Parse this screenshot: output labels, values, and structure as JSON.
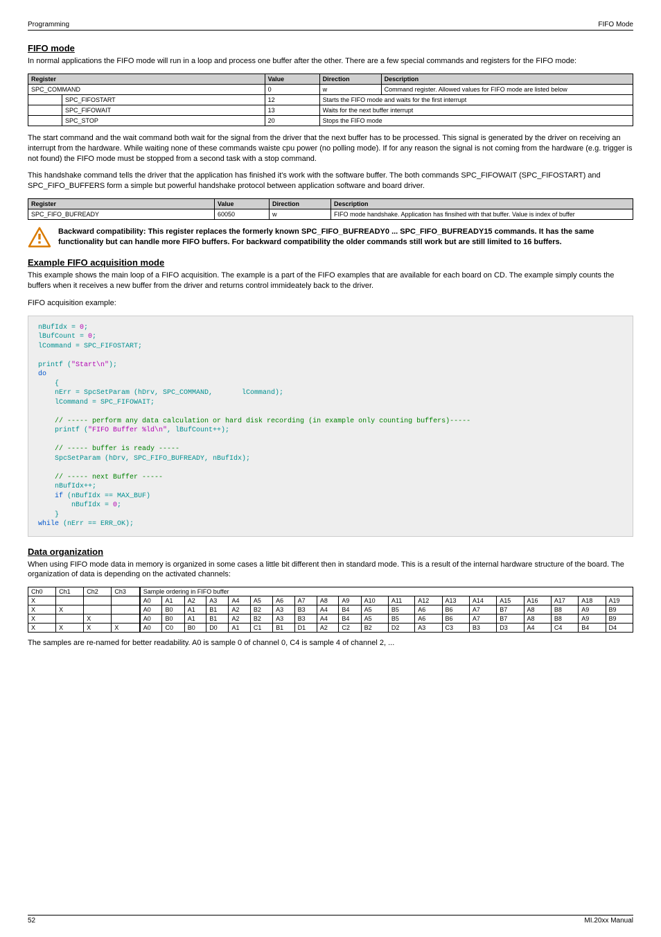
{
  "topbar": {
    "left": "Programming",
    "right": "FIFO Mode"
  },
  "sec1": {
    "title": "FIFO mode",
    "p1": "In normal applications the FIFO mode will run in a loop and process one buffer after the other. There are a few special commands and registers for the FIFO mode:"
  },
  "tbl1": {
    "h1": "Register",
    "h2": "Value",
    "h3": "Direction",
    "h4": "Description",
    "r1c1": "SPC_COMMAND",
    "r1c2": "0",
    "r1c3": "w",
    "r1c4": "Command register. Allowed values for FIFO mode are listed below",
    "r2c1": "SPC_FIFOSTART",
    "r2c2": "12",
    "r2c3": "Starts the FIFO mode and waits for the first interrupt",
    "r3c1": "SPC_FIFOWAIT",
    "r3c2": "13",
    "r3c3": "Waits for the next buffer interrupt",
    "r4c1": "SPC_STOP",
    "r4c2": "20",
    "r4c3": "Stops the FIFO mode"
  },
  "p2": "The start command and the wait command both wait for the signal from the driver that the next buffer has to be processed. This signal is generated by the driver on receiving an interrupt from the hardware. While waiting none of these commands waiste cpu power (no polling mode). If for any reason the signal is not coming from the hardware (e.g. trigger is not found) the FIFO mode must be stopped from a second task with a stop command.",
  "p3": "This handshake command tells the driver that the application has finished it's work with the software buffer. The both commands SPC_FIFOWAIT (SPC_FIFOSTART) and SPC_FIFO_BUFFERS form a simple but powerful handshake protocol between application software and board driver.",
  "tbl2": {
    "h1": "Register",
    "h2": "Value",
    "h3": "Direction",
    "h4": "Description",
    "r1c1": "SPC_FIFO_BUFREADY",
    "r1c2": "60050",
    "r1c3": "w",
    "r1c4": "FIFO mode handshake. Application has finsihed with that buffer. Value is index of buffer"
  },
  "warn": "Backward compatibility: This register replaces the formerly known SPC_FIFO_BUFREADY0 ... SPC_FIFO_BUFREADY15 commands. It has the same functionality but can handle more FIFO buffers. For backward compatibility the older commands still work but are still limited to 16 buffers.",
  "sec2": {
    "title": "Example FIFO acquisition mode",
    "p1": "This example shows the main loop of a FIFO acquisition. The example is a part of the FIFO examples that are available for each board on CD. The example simply counts the buffers when it receives a new buffer from the driver and returns control immideately back to the driver.",
    "p2": "FIFO acquisition example:"
  },
  "code": {
    "l01a": "nBufIdx = ",
    "l01b": "0",
    "l01c": ";",
    "l02a": "lBufCount = ",
    "l02b": "0",
    "l02c": ";",
    "l03a": "lCommand = SPC_FIFOSTART;",
    "l04a": "printf (",
    "l04b": "\"Start\\n\"",
    "l04c": ");",
    "l05": "do",
    "l06": "    {",
    "l07a": "    nErr = SpcSetParam (hDrv, SPC_COMMAND,       lCommand);",
    "l08": "    lCommand = SPC_FIFOWAIT;",
    "l09": "    // ----- perform any data calculation or hard disk recording (in example only counting buffers)-----",
    "l10a": "    printf (",
    "l10b": "\"FIFO Buffer %ld\\n\"",
    "l10c": ", lBufCount++);",
    "l11": "    // ----- buffer is ready -----",
    "l12": "    SpcSetParam (hDrv, SPC_FIFO_BUFREADY, nBufIdx);",
    "l13": "    // ----- next Buffer -----",
    "l14": "    nBufIdx++;",
    "l15a": "    ",
    "l15b": "if",
    "l15c": " (nBufIdx == MAX_BUF)",
    "l16a": "        nBufIdx = ",
    "l16b": "0",
    "l16c": ";",
    "l17": "    }",
    "l18a": "while",
    "l18b": " (nErr == ERR_OK);"
  },
  "sec3": {
    "title": "Data organization",
    "p1": "When using FIFO mode data in memory is organized in some cases a little bit different then in standard mode. This is a result of the internal hardware structure of the board. The organization of data is depending on the activated channels:"
  },
  "org": {
    "hdr": [
      "Ch0",
      "Ch1",
      "Ch2",
      "Ch3",
      "Sample ordering in FIFO buffer"
    ],
    "cols": [
      "A0",
      "A1",
      "A2",
      "A3",
      "A4",
      "A5",
      "A6",
      "A7",
      "A8",
      "A9",
      "A10",
      "A11",
      "A12",
      "A13",
      "A14",
      "A15",
      "A16",
      "A17",
      "A18",
      "A19"
    ],
    "rows": [
      {
        "ch": [
          "X",
          "",
          "",
          ""
        ],
        "d": [
          "A0",
          "A1",
          "A2",
          "A3",
          "A4",
          "A5",
          "A6",
          "A7",
          "A8",
          "A9",
          "A10",
          "A11",
          "A12",
          "A13",
          "A14",
          "A15",
          "A16",
          "A17",
          "A18",
          "A19"
        ]
      },
      {
        "ch": [
          "X",
          "X",
          "",
          ""
        ],
        "d": [
          "A0",
          "B0",
          "A1",
          "B1",
          "A2",
          "B2",
          "A3",
          "B3",
          "A4",
          "B4",
          "A5",
          "B5",
          "A6",
          "B6",
          "A7",
          "B7",
          "A8",
          "B8",
          "A9",
          "B9"
        ]
      },
      {
        "ch": [
          "X",
          "",
          "X",
          ""
        ],
        "d": [
          "A0",
          "B0",
          "A1",
          "B1",
          "A2",
          "B2",
          "A3",
          "B3",
          "A4",
          "B4",
          "A5",
          "B5",
          "A6",
          "B6",
          "A7",
          "B7",
          "A8",
          "B8",
          "A9",
          "B9"
        ]
      },
      {
        "ch": [
          "X",
          "X",
          "X",
          "X"
        ],
        "d": [
          "A0",
          "C0",
          "B0",
          "D0",
          "A1",
          "C1",
          "B1",
          "D1",
          "A2",
          "C2",
          "B2",
          "D2",
          "A3",
          "C3",
          "B3",
          "D3",
          "A4",
          "C4",
          "B4",
          "D4"
        ]
      }
    ]
  },
  "p4": "The samples are re-named for better readability. A0 is sample 0 of channel 0, C4 is sample 4 of channel 2, ...",
  "footer": {
    "left": "52",
    "right": "MI.20xx Manual"
  }
}
